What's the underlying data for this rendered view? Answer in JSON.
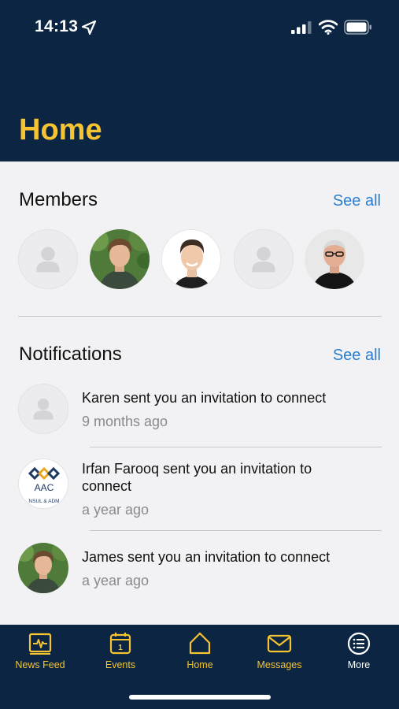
{
  "status_bar": {
    "time": "14:13",
    "icons": [
      "location-arrow-icon",
      "cellular-signal-icon",
      "wifi-icon",
      "battery-icon"
    ]
  },
  "header": {
    "title": "Home"
  },
  "members": {
    "title": "Members",
    "see_all": "See all",
    "avatars": [
      "placeholder",
      "photo",
      "photo",
      "placeholder",
      "photo"
    ]
  },
  "notifications": {
    "title": "Notifications",
    "see_all": "See all",
    "items": [
      {
        "text": "Karen sent you an invitation to connect",
        "time": "9 months ago",
        "avatar": "placeholder"
      },
      {
        "text": "Irfan Farooq sent you an invitation to connect",
        "time": "a year ago",
        "avatar": "logo",
        "logo_text": "AAC",
        "logo_subtext": "NSUL & ADM"
      },
      {
        "text": "James sent you an invitation to connect",
        "time": "a year ago",
        "avatar": "photo"
      }
    ]
  },
  "tabbar": {
    "tabs": [
      {
        "label": "News Feed",
        "icon": "news-feed-icon"
      },
      {
        "label": "Events",
        "icon": "calendar-icon",
        "badge": "1"
      },
      {
        "label": "Home",
        "icon": "house-icon"
      },
      {
        "label": "Messages",
        "icon": "envelope-icon"
      },
      {
        "label": "More",
        "icon": "more-list-icon"
      }
    ]
  },
  "colors": {
    "navy": "#0b2542",
    "gold": "#f5c430",
    "link_blue": "#2a7fd0",
    "background": "#f2f2f4"
  }
}
